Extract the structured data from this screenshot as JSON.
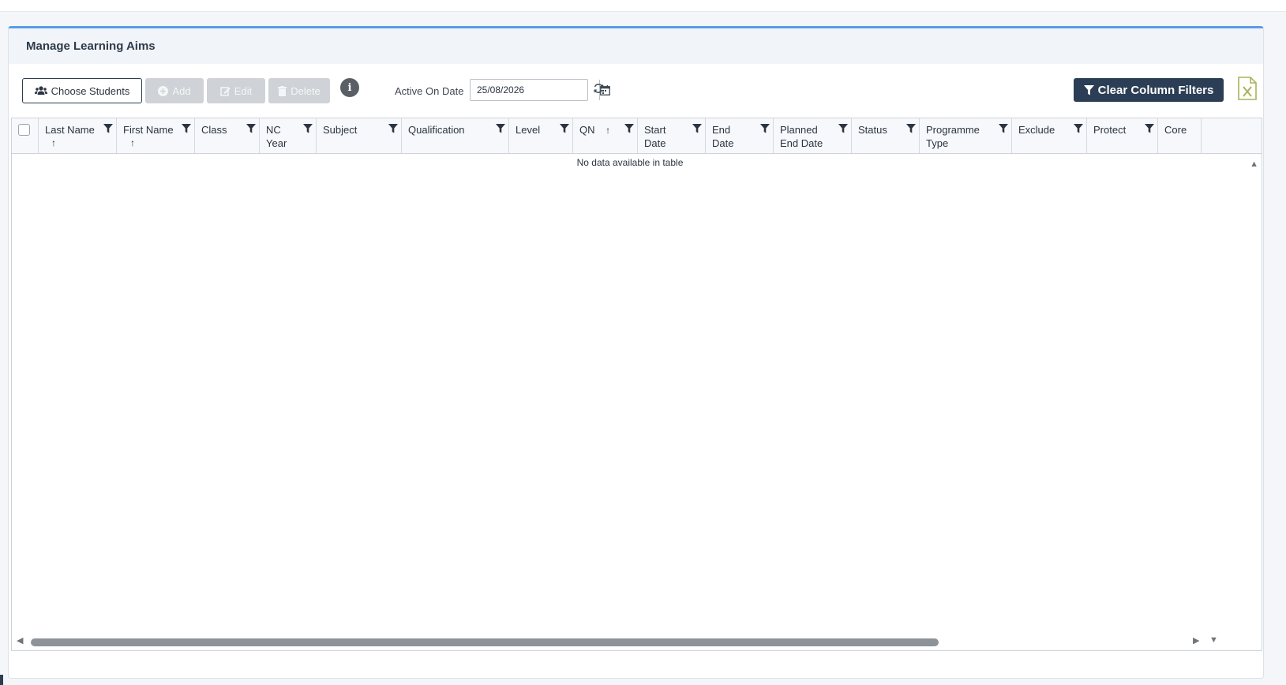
{
  "panel": {
    "title": "Manage Learning Aims"
  },
  "toolbar": {
    "choose_students": "Choose Students",
    "add": "Add",
    "edit": "Edit",
    "delete": "Delete",
    "info_icon": "info-icon",
    "active_on_date_label": "Active On Date",
    "active_on_date_value": "25/08/2026",
    "clear_filters": "Clear Column Filters",
    "excel_icon": "excel-export-icon"
  },
  "grid": {
    "columns": [
      {
        "label": "Last Name",
        "sort": "↑"
      },
      {
        "label": "First Name",
        "sort": "↑"
      },
      {
        "label": "Class"
      },
      {
        "label": "NC Year"
      },
      {
        "label": "Subject"
      },
      {
        "label": "Qualification"
      },
      {
        "label": "Level"
      },
      {
        "label": "QN",
        "sort": "↑"
      },
      {
        "label": "Start Date"
      },
      {
        "label": "End Date"
      },
      {
        "label": "Planned End Date"
      },
      {
        "label": "Status"
      },
      {
        "label": "Programme Type"
      },
      {
        "label": "Exclude"
      },
      {
        "label": "Protect"
      },
      {
        "label": "Core"
      }
    ],
    "empty_message": "No data available in table"
  },
  "colors": {
    "accent": "#5b9be6",
    "dark_button": "#2c3e55",
    "disabled_button": "#cfd2d6",
    "excel_green": "#a9b35a"
  }
}
